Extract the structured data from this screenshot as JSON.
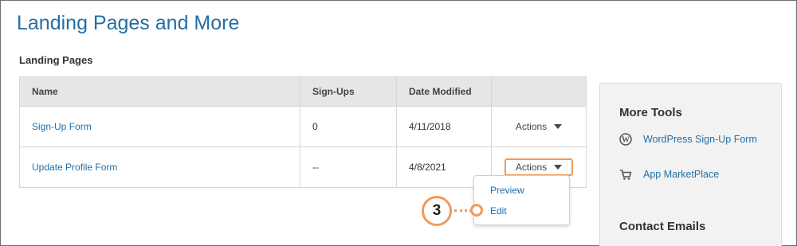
{
  "page": {
    "title": "Landing Pages and More"
  },
  "landing_pages": {
    "section_title": "Landing Pages",
    "columns": [
      "Name",
      "Sign-Ups",
      "Date Modified",
      ""
    ],
    "rows": [
      {
        "name": "Sign-Up Form",
        "signups": "0",
        "date_modified": "4/11/2018",
        "actions_label": "Actions"
      },
      {
        "name": "Update Profile Form",
        "signups": "--",
        "date_modified": "4/8/2021",
        "actions_label": "Actions"
      }
    ]
  },
  "actions_menu": {
    "items": [
      "Preview",
      "Edit"
    ]
  },
  "callout": {
    "step": "3"
  },
  "sidebar": {
    "more_tools_title": "More Tools",
    "links": [
      {
        "label": "WordPress Sign-Up Form",
        "icon": "wordpress-icon"
      },
      {
        "label": "App MarketPlace",
        "icon": "cart-icon"
      }
    ],
    "contact_emails_title": "Contact Emails"
  },
  "colors": {
    "title_blue": "#256fa3",
    "link_blue": "#1f6fa8",
    "callout_orange": "#ef9a5b"
  }
}
